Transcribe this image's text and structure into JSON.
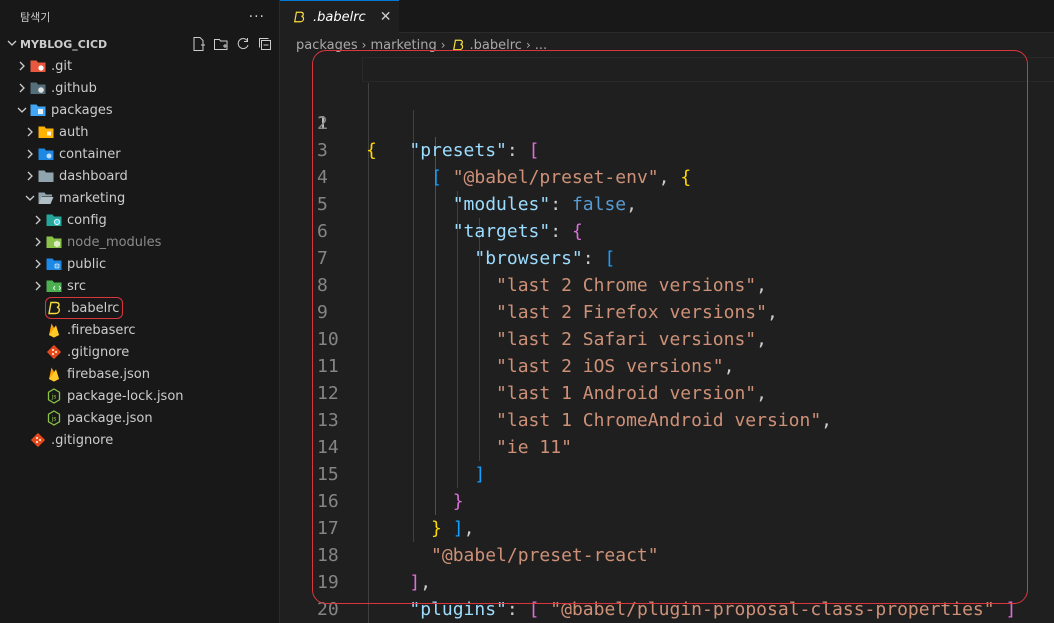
{
  "sidebar": {
    "title": "탐색기",
    "more": "···",
    "section": "MYBLOG_CICD",
    "items": [
      {
        "label": ".git",
        "icon": "git-folder-icon",
        "expanded": false
      },
      {
        "label": ".github",
        "icon": "github-folder-icon",
        "expanded": false
      },
      {
        "label": "packages",
        "icon": "packages-folder-icon",
        "expanded": true
      },
      {
        "label": "auth",
        "icon": "folder-icon",
        "expanded": false
      },
      {
        "label": "container",
        "icon": "folder-icon",
        "expanded": false
      },
      {
        "label": "dashboard",
        "icon": "folder-icon",
        "expanded": false
      },
      {
        "label": "marketing",
        "icon": "folder-open-icon",
        "expanded": true
      },
      {
        "label": "config",
        "icon": "config-folder-icon",
        "expanded": false
      },
      {
        "label": "node_modules",
        "icon": "node-modules-folder-icon",
        "expanded": false
      },
      {
        "label": "public",
        "icon": "public-folder-icon",
        "expanded": false
      },
      {
        "label": "src",
        "icon": "src-folder-icon",
        "expanded": false
      },
      {
        "label": ".babelrc",
        "icon": "babel-file-icon"
      },
      {
        "label": ".firebaserc",
        "icon": "firebase-file-icon"
      },
      {
        "label": ".gitignore",
        "icon": "git-file-icon"
      },
      {
        "label": "firebase.json",
        "icon": "firebase-file-icon"
      },
      {
        "label": "package-lock.json",
        "icon": "node-file-icon"
      },
      {
        "label": "package.json",
        "icon": "node-file-icon"
      },
      {
        "label": ".gitignore",
        "icon": "git-file-icon"
      }
    ]
  },
  "editor": {
    "tab_label": ".babelrc",
    "tab_close": "✕",
    "breadcrumb": [
      "packages",
      "marketing",
      ".babelrc",
      "..."
    ],
    "line_numbers": [
      "1",
      "2",
      "3",
      "4",
      "5",
      "6",
      "7",
      "8",
      "9",
      "10",
      "11",
      "12",
      "13",
      "14",
      "15",
      "16",
      "17",
      "18",
      "19",
      "20"
    ],
    "code": {
      "presets_key": "\"presets\"",
      "preset_env": "\"@babel/preset-env\"",
      "modules_key": "\"modules\"",
      "modules_val": "false",
      "targets_key": "\"targets\"",
      "browsers_key": "\"browsers\"",
      "browsers": [
        "\"last 2 Chrome versions\"",
        "\"last 2 Firefox versions\"",
        "\"last 2 Safari versions\"",
        "\"last 2 iOS versions\"",
        "\"last 1 Android version\"",
        "\"last 1 ChromeAndroid version\"",
        "\"ie 11\""
      ],
      "preset_react": "\"@babel/preset-react\"",
      "plugins_key": "\"plugins\"",
      "plugin": "\"@babel/plugin-proposal-class-properties\""
    }
  },
  "colors": {
    "annotation_red": "#d9363e",
    "accent": "#0078d4"
  }
}
